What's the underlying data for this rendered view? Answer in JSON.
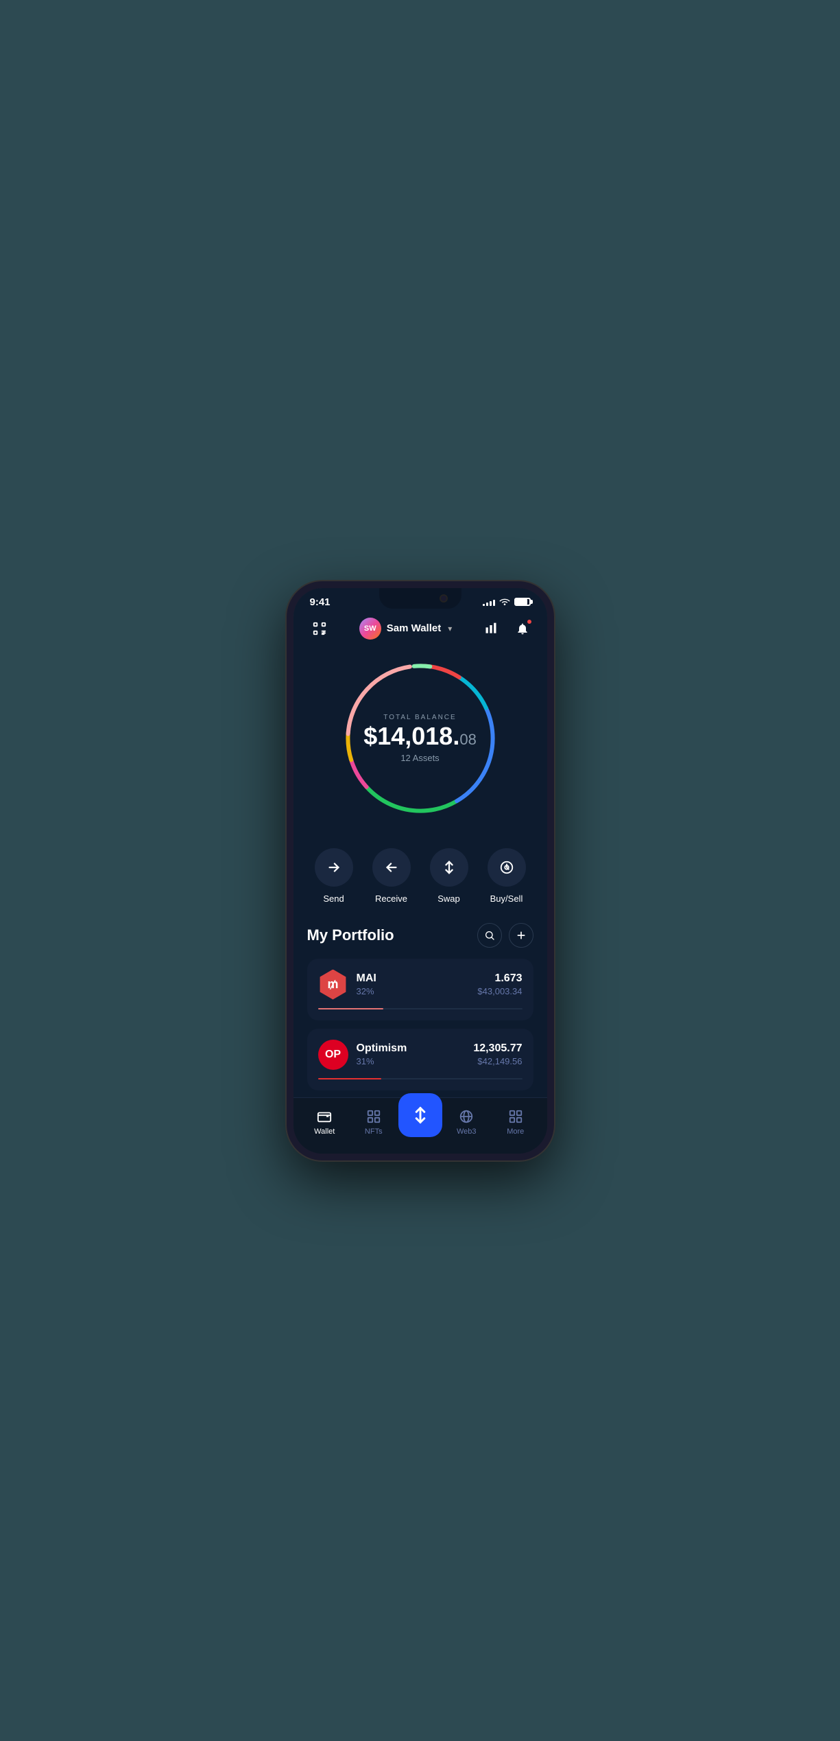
{
  "status_bar": {
    "time": "9:41",
    "signal_bars": [
      3,
      5,
      7,
      9,
      11
    ],
    "battery_level": 90
  },
  "header": {
    "scan_label": "scan",
    "wallet_name": "Sam Wallet",
    "avatar_initials": "SW",
    "chevron": "▾",
    "chart_label": "chart",
    "bell_label": "notifications"
  },
  "balance": {
    "label": "TOTAL BALANCE",
    "amount_main": "$14,018.",
    "amount_cents": "08",
    "assets_label": "12 Assets"
  },
  "actions": [
    {
      "id": "send",
      "label": "Send",
      "icon": "→"
    },
    {
      "id": "receive",
      "label": "Receive",
      "icon": "←"
    },
    {
      "id": "swap",
      "label": "Swap",
      "icon": "⇅"
    },
    {
      "id": "buysell",
      "label": "Buy/Sell",
      "icon": "©"
    }
  ],
  "portfolio": {
    "title": "My Portfolio",
    "search_label": "search",
    "add_label": "add",
    "assets": [
      {
        "id": "mai",
        "name": "MAI",
        "pct": "32%",
        "amount": "1.673",
        "value": "$43,003.34",
        "progress": 32,
        "progress_color": "#e57373",
        "icon_label": "M",
        "icon_bg": "#d44444"
      },
      {
        "id": "optimism",
        "name": "Optimism",
        "pct": "31%",
        "amount": "12,305.77",
        "value": "$42,149.56",
        "progress": 31,
        "progress_color": "#e53030",
        "icon_label": "OP",
        "icon_bg": "#cc0000"
      }
    ]
  },
  "bottom_nav": {
    "items": [
      {
        "id": "wallet",
        "label": "Wallet",
        "active": true
      },
      {
        "id": "nfts",
        "label": "NFTs",
        "active": false
      },
      {
        "id": "swap_center",
        "label": "",
        "active": false,
        "is_center": true
      },
      {
        "id": "web3",
        "label": "Web3",
        "active": false
      },
      {
        "id": "more",
        "label": "More",
        "active": false
      }
    ]
  },
  "colors": {
    "bg": "#0d1b2e",
    "card_bg": "#121f35",
    "accent_blue": "#2255ff",
    "text_primary": "#ffffff",
    "text_secondary": "#6677aa",
    "text_muted": "#8899aa"
  }
}
